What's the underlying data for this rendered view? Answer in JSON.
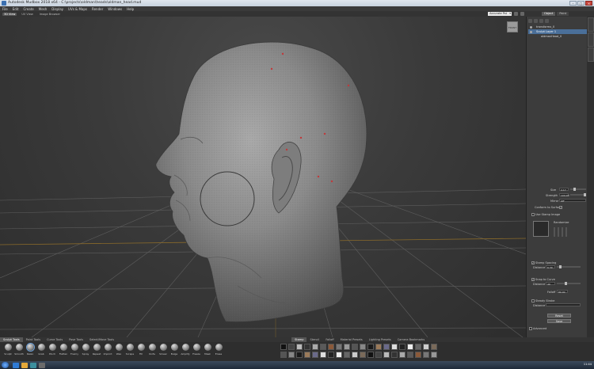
{
  "window": {
    "title": "Autodesk Mudbox 2018 x64 - C:\\projects\\oldman\\heads\\oldman_head.mud"
  },
  "menu": [
    "File",
    "Edit",
    "Create",
    "Mesh",
    "Display",
    "UVs & Maps",
    "Render",
    "Windows",
    "Help"
  ],
  "toolbar": {
    "items": [
      {
        "label": "3D View",
        "active": true
      },
      {
        "label": "UV View",
        "active": false
      },
      {
        "label": "Image Browser",
        "active": false
      }
    ],
    "camera_select": "Accurate Pst"
  },
  "right_panel": {
    "tabs": [
      {
        "label": "Object",
        "active": true
      },
      {
        "label": "Paint",
        "active": false
      }
    ],
    "outliner": [
      {
        "label": "transformx_0",
        "selected": false
      },
      {
        "label": "Sculpt Layer 1",
        "selected": true
      },
      {
        "label": "oldmanHead_0",
        "selected": false
      }
    ],
    "properties": {
      "size_label": "Size",
      "size_value": "4.17",
      "strength_label": "Strength",
      "strength_value": "100.00",
      "mirror_label": "Mirror",
      "mirror_value": "Off",
      "conform_label": "Conform to Surface",
      "stamp_label": "Use Stamp Image",
      "randomize_label": "Randomize",
      "stamp_spacing_label": "Stamp Spacing",
      "stamp_distance_label": "Distance",
      "stamp_distance_value": "6.39",
      "snap_label": "Snap to Curve",
      "snap_distance_label": "Distance",
      "snap_distance_value": "40",
      "falloff_label": "Falloff",
      "falloff_value": "80.00",
      "steady_label": "Steady Stroke",
      "steady_distance_label": "Distance",
      "reset_label": "Reset",
      "save_label": "Save",
      "advanced_label": "Advanced"
    }
  },
  "tray": {
    "left_tabs": [
      {
        "label": "Sculpt Tools",
        "active": true
      },
      {
        "label": "Paint Tools",
        "active": false
      },
      {
        "label": "Curve Tools",
        "active": false
      },
      {
        "label": "Pose Tools",
        "active": false
      },
      {
        "label": "Select/Move Tools",
        "active": false
      }
    ],
    "right_tabs": [
      {
        "label": "Stamp",
        "active": true
      },
      {
        "label": "Stencil",
        "active": false
      },
      {
        "label": "Falloff",
        "active": false
      },
      {
        "label": "Material Presets",
        "active": false
      },
      {
        "label": "Lighting Presets",
        "active": false
      },
      {
        "label": "Camera Bookmarks",
        "active": false
      }
    ],
    "tools": [
      {
        "label": "Sculpt",
        "active": false
      },
      {
        "label": "Smooth",
        "active": false
      },
      {
        "label": "Relax",
        "active": true
      },
      {
        "label": "Grab",
        "active": false
      },
      {
        "label": "Pinch",
        "active": false
      },
      {
        "label": "Flatten",
        "active": false
      },
      {
        "label": "Foamy",
        "active": false
      },
      {
        "label": "Spray",
        "active": false
      },
      {
        "label": "Repeat",
        "active": false
      },
      {
        "label": "Imprint",
        "active": false
      },
      {
        "label": "Wax",
        "active": false
      },
      {
        "label": "Scrape",
        "active": false
      },
      {
        "label": "Fill",
        "active": false
      },
      {
        "label": "Knife",
        "active": false
      },
      {
        "label": "Smear",
        "active": false
      },
      {
        "label": "Bulge",
        "active": false
      },
      {
        "label": "Amplify",
        "active": false
      },
      {
        "label": "Freeze",
        "active": false
      },
      {
        "label": "Mask",
        "active": false
      },
      {
        "label": "Erase",
        "active": false
      }
    ]
  },
  "taskbar": {
    "clock": "11:44"
  }
}
